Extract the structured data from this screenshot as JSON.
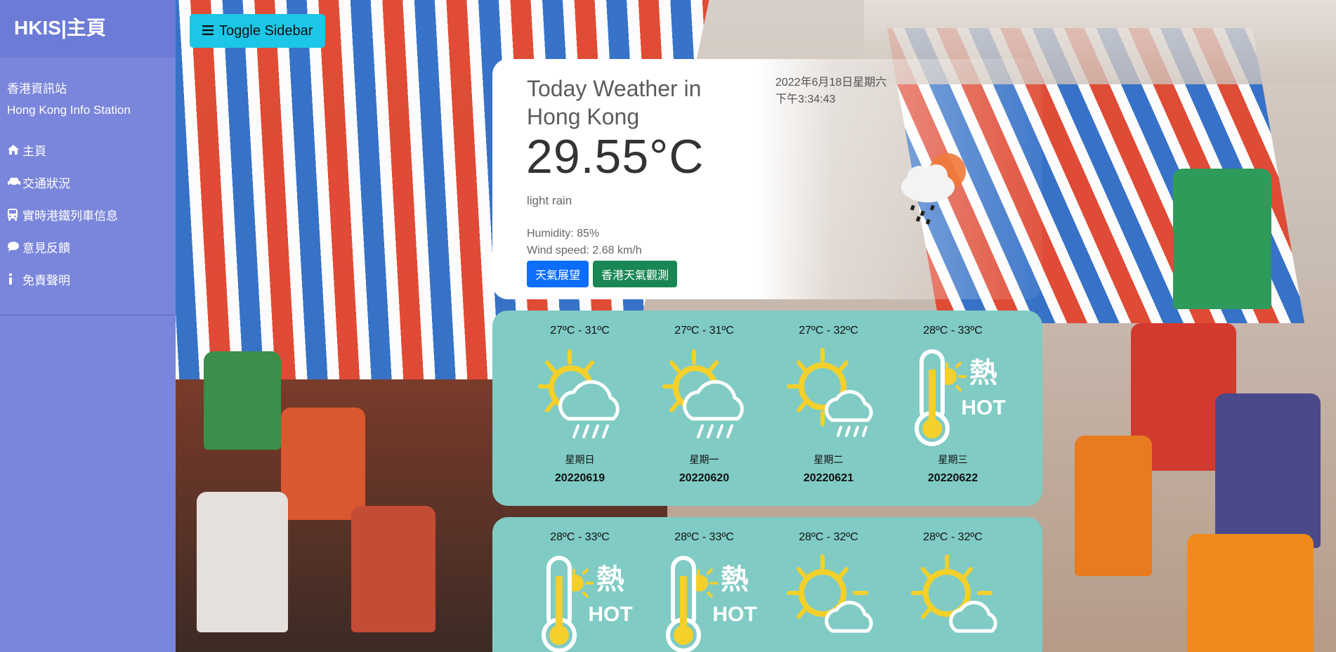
{
  "sidebar": {
    "brand": "HKIS|主頁",
    "subtitle_zh": "香港資訊站",
    "subtitle_en": "Hong Kong Info Station",
    "items": [
      {
        "icon": "home-icon",
        "label": "主頁"
      },
      {
        "icon": "car-icon",
        "label": "交通狀況"
      },
      {
        "icon": "bus-icon",
        "label": "實時港鐵列車信息"
      },
      {
        "icon": "chat-bubble-icon",
        "label": "意見反饋"
      },
      {
        "icon": "info-icon",
        "label": "免責聲明"
      }
    ]
  },
  "toggle": {
    "icon": "menu-icon",
    "label": "Toggle Sidebar"
  },
  "current": {
    "title": "Today Weather in Hong Kong",
    "temperature": "29.55°C",
    "description": "light rain",
    "date": "2022年6月18日星期六",
    "time": "下午3:34:43",
    "humidity": "Humidity: 85%",
    "wind": "Wind speed: 2.68 km/h",
    "icon": "sun-cloud-rain-icon",
    "buttons": {
      "outlook": "天氣展望",
      "hko": "香港天氣觀測"
    }
  },
  "forecast": [
    {
      "range": "27ºC - 31ºC",
      "weekday": "星期日",
      "date": "20220619",
      "icon": "sun-cloud-rain-icon"
    },
    {
      "range": "27ºC - 31ºC",
      "weekday": "星期一",
      "date": "20220620",
      "icon": "sun-cloud-rain-icon"
    },
    {
      "range": "27ºC - 32ºC",
      "weekday": "星期二",
      "date": "20220621",
      "icon": "sun-cloud-drizzle-icon"
    },
    {
      "range": "28ºC - 33ºC",
      "weekday": "星期三",
      "date": "20220622",
      "icon": "hot-thermometer-icon",
      "icon_text_zh": "熱",
      "icon_text_en": "HOT"
    },
    {
      "range": "28ºC - 33ºC",
      "icon": "hot-thermometer-icon",
      "icon_text_zh": "熱",
      "icon_text_en": "HOT"
    },
    {
      "range": "28ºC - 33ºC",
      "icon": "hot-thermometer-icon",
      "icon_text_zh": "熱",
      "icon_text_en": "HOT"
    },
    {
      "range": "28ºC - 32ºC",
      "icon": "sun-cloud-icon"
    },
    {
      "range": "28ºC - 32ºC",
      "icon": "sun-cloud-icon"
    }
  ],
  "colors": {
    "sidebar": "#7a86db",
    "sidebar_brand": "#6c7bd6",
    "toggle": "#1cc6e6",
    "forecast_card": "#80cbc4",
    "primary_button": "#0d6efd",
    "success_button": "#198754",
    "sun": "#f5d02a"
  }
}
